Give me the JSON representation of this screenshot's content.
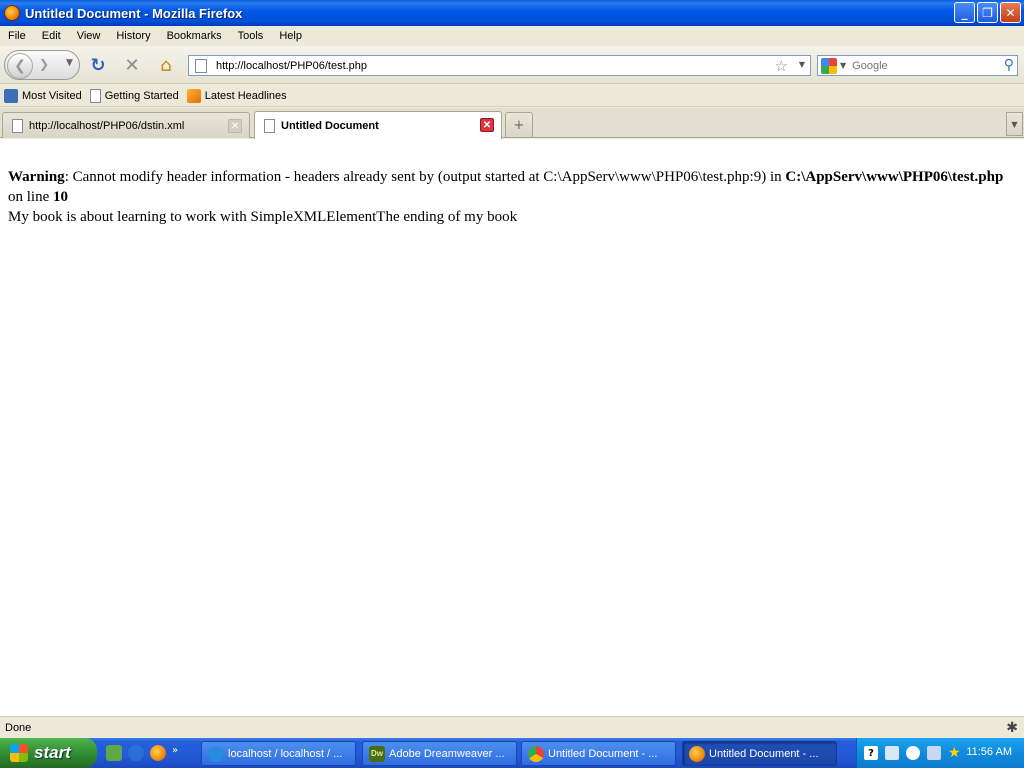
{
  "window": {
    "title": "Untitled Document - Mozilla Firefox"
  },
  "menu": [
    "File",
    "Edit",
    "View",
    "History",
    "Bookmarks",
    "Tools",
    "Help"
  ],
  "navbar": {
    "url": "http://localhost/PHP06/test.php",
    "search_placeholder": "Google"
  },
  "bookmarks": [
    "Most Visited",
    "Getting Started",
    "Latest Headlines"
  ],
  "tabs": [
    {
      "label": "http://localhost/PHP06/dstin.xml"
    },
    {
      "label": "Untitled Document"
    }
  ],
  "content": {
    "warning_label": "Warning",
    "warning_text": ": Cannot modify header information - headers already sent by (output started at C:\\AppServ\\www\\PHP06\\test.php:9) in ",
    "warning_file": "C:\\AppServ\\www\\PHP06\\test.php",
    "online_text": " on line ",
    "line_number": "10",
    "body_text": "My book is about learning to work with SimpleXMLElementThe ending of my book"
  },
  "status": {
    "text": "Done"
  },
  "taskbar": {
    "start_label": "start",
    "tasks": [
      "localhost / localhost / ...",
      "Adobe Dreamweaver ...",
      "Untitled Document - ...",
      "Untitled Document - ..."
    ],
    "clock": "11:56 AM"
  }
}
